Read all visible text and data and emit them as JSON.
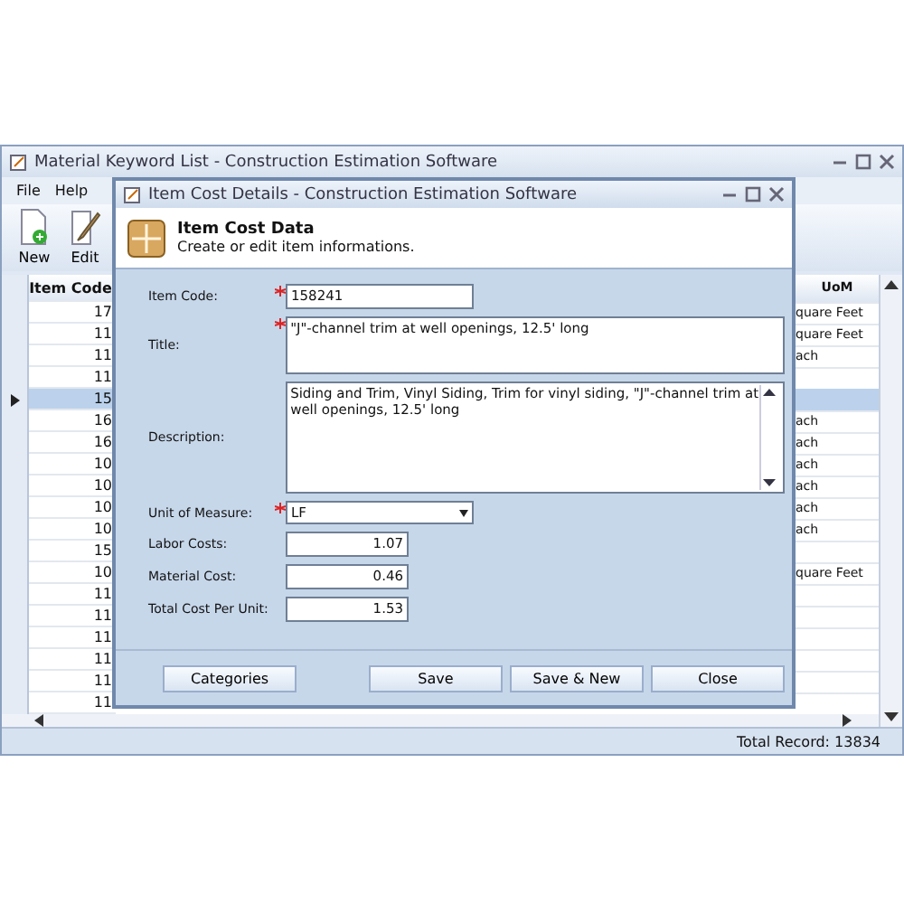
{
  "main_window": {
    "title": "Material Keyword List - Construction Estimation Software",
    "menu": [
      "File",
      "Help"
    ],
    "toolbar": [
      {
        "label": "New",
        "kind": "new"
      },
      {
        "label": "Edit",
        "kind": "edit"
      }
    ],
    "grid": {
      "columns": [
        "Item Code",
        "UoM"
      ],
      "rows": [
        {
          "item_code": "17",
          "uom": "quare Feet",
          "selected": false
        },
        {
          "item_code": "11",
          "uom": "quare Feet",
          "selected": false
        },
        {
          "item_code": "11",
          "uom": "ach",
          "selected": false
        },
        {
          "item_code": "11",
          "uom": "",
          "selected": false
        },
        {
          "item_code": "15",
          "uom": "",
          "selected": true
        },
        {
          "item_code": "16",
          "uom": "ach",
          "selected": false
        },
        {
          "item_code": "16",
          "uom": "ach",
          "selected": false
        },
        {
          "item_code": "10",
          "uom": "ach",
          "selected": false
        },
        {
          "item_code": "10",
          "uom": "ach",
          "selected": false
        },
        {
          "item_code": "10",
          "uom": "ach",
          "selected": false
        },
        {
          "item_code": "10",
          "uom": "ach",
          "selected": false
        },
        {
          "item_code": "15",
          "uom": "",
          "selected": false
        },
        {
          "item_code": "10",
          "uom": "quare Feet",
          "selected": false
        },
        {
          "item_code": "11",
          "uom": "",
          "selected": false
        },
        {
          "item_code": "11",
          "uom": "",
          "selected": false
        },
        {
          "item_code": "11",
          "uom": "",
          "selected": false
        },
        {
          "item_code": "11",
          "uom": "",
          "selected": false
        },
        {
          "item_code": "11",
          "uom": "",
          "selected": false
        },
        {
          "item_code": "11",
          "uom": "",
          "selected": false
        }
      ]
    },
    "status_bar": "Total Record: 13834"
  },
  "dialog": {
    "title": "Item Cost Details - Construction Estimation Software",
    "header": {
      "title": "Item Cost Data",
      "subtitle": "Create or edit item informations."
    },
    "fields": [
      {
        "label": "Item Code:",
        "kind": "text",
        "value": "158241",
        "required": true
      },
      {
        "label": "Title:",
        "kind": "textarea",
        "value": "\"J\"-channel trim at well openings, 12.5' long",
        "required": true
      },
      {
        "label": "Description:",
        "kind": "memo",
        "value": "Siding and Trim, Vinyl Siding, Trim for vinyl siding, \"J\"-channel trim at well openings, 12.5' long",
        "required": false
      },
      {
        "label": "Unit of Measure:",
        "kind": "dropdown",
        "value": "LF",
        "required": true
      },
      {
        "label": "Labor Costs:",
        "kind": "number",
        "value": "1.07",
        "required": false
      },
      {
        "label": "Material Cost:",
        "kind": "number",
        "value": "0.46",
        "required": false
      },
      {
        "label": "Total Cost Per Unit:",
        "kind": "number",
        "value": "1.53",
        "required": false
      }
    ],
    "buttons": [
      {
        "label": "Categories",
        "kind": "left"
      },
      {
        "label": "Save",
        "kind": "right"
      },
      {
        "label": "Save & New",
        "kind": "right"
      },
      {
        "label": "Close",
        "kind": "right"
      }
    ]
  }
}
